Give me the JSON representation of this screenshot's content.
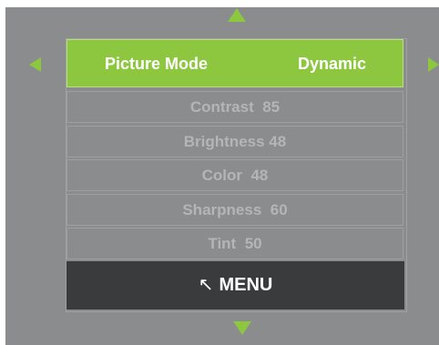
{
  "accent_color": "#8dc63f",
  "panel_color": "#8a8c8e",
  "selected": {
    "label": "Picture Mode",
    "value": "Dynamic"
  },
  "settings": [
    {
      "label": "Contrast",
      "value": "85"
    },
    {
      "label": "Brightness",
      "value": "48"
    },
    {
      "label": "Color",
      "value": "48"
    },
    {
      "label": "Sharpness",
      "value": "60"
    },
    {
      "label": "Tint",
      "value": "50"
    }
  ],
  "footer": {
    "icon": "back-arrow-icon",
    "glyph": "↖",
    "label": "MENU"
  }
}
